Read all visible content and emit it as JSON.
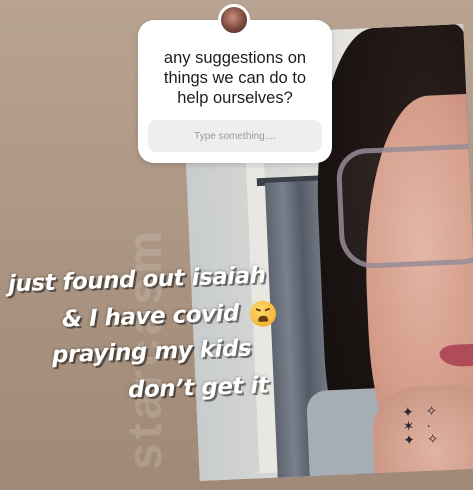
{
  "question_sticker": {
    "question": "any suggestions on things we can do to help ourselves?",
    "answer_placeholder": "Type something...."
  },
  "caption": {
    "line1": "just found out isaiah",
    "line2": "& I have covid",
    "line3": "praying my kids",
    "line4": "don’t get it",
    "emoji": "weary-face-emoji"
  },
  "watermark": "starcasm",
  "colors": {
    "background": "#b09a88",
    "sticker_bg": "#ffffff",
    "answer_box_bg": "#eeeeee",
    "caption_text": "#ffffff"
  }
}
